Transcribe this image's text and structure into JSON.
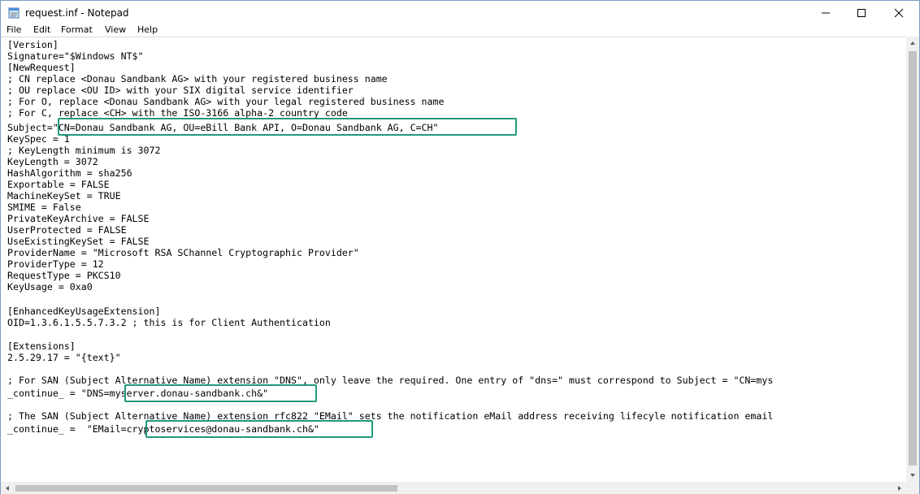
{
  "window": {
    "title": "request.inf - Notepad",
    "icon": "notepad-icon"
  },
  "menu": [
    "File",
    "Edit",
    "Format",
    "View",
    "Help"
  ],
  "lines": [
    "[Version]",
    "Signature=\"$Windows NT$\"",
    "[NewRequest]",
    "; CN replace <Donau Sandbank AG> with your registered business name",
    "; OU replace <OU ID> with your SIX digital service identifier",
    "; For O, replace <Donau Sandbank AG> with your legal registered business name",
    "; For C, replace <CH> with the ISO-3166 alpha-2 country code",
    "Subject=\"CN=Donau Sandbank AG, OU=eBill Bank API, O=Donau Sandbank AG, C=CH\"",
    "KeySpec = 1",
    "; KeyLength minimum is 3072",
    "KeyLength = 3072",
    "HashAlgorithm = sha256",
    "Exportable = FALSE",
    "MachineKeySet = TRUE",
    "SMIME = False",
    "PrivateKeyArchive = FALSE",
    "UserProtected = FALSE",
    "UseExistingKeySet = FALSE",
    "ProviderName = \"Microsoft RSA SChannel Cryptographic Provider\"",
    "ProviderType = 12",
    "RequestType = PKCS10",
    "KeyUsage = 0xa0",
    "",
    "[EnhancedKeyUsageExtension]",
    "OID=1.3.6.1.5.5.7.3.2 ; this is for Client Authentication",
    "",
    "[Extensions]",
    "2.5.29.17 = \"{text}\"",
    "",
    "; For SAN (Subject Alternative Name) extension \"DNS\", only leave the required. One entry of \"dns=\" must correspond to Subject = \"CN=mys",
    "_continue_ = \"DNS=myserver.donau-sandbank.ch&\"",
    "",
    "; The SAN (Subject Alternative Name) extension rfc822 \"EMail\" sets the notification eMail address receiving lifecyle notification email",
    "_continue_ =  \"EMail=cryptoservices@donau-sandbank.ch&\""
  ],
  "accent_color": "#1f9a7c"
}
